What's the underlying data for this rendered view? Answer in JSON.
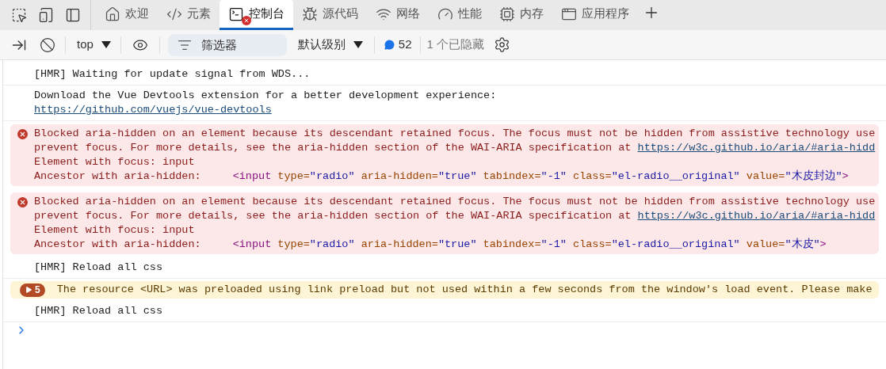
{
  "toolbar": {
    "tools": [
      {
        "kind": "inspect"
      },
      {
        "kind": "device"
      },
      {
        "kind": "dock"
      }
    ],
    "tabs": [
      {
        "kind": "home",
        "label": "欢迎",
        "selected": false,
        "error": false
      },
      {
        "kind": "code",
        "label": "元素",
        "selected": false,
        "error": false
      },
      {
        "kind": "terminal",
        "label": "控制台",
        "selected": true,
        "error": true
      },
      {
        "kind": "bug",
        "label": "源代码",
        "selected": false,
        "error": false
      },
      {
        "kind": "wifi",
        "label": "网络",
        "selected": false,
        "error": false
      },
      {
        "kind": "gauge",
        "label": "性能",
        "selected": false,
        "error": false
      },
      {
        "kind": "chip",
        "label": "内存",
        "selected": false,
        "error": false
      },
      {
        "kind": "window",
        "label": "应用程序",
        "selected": false,
        "error": false
      }
    ]
  },
  "console_bar": {
    "context": "top",
    "filter": {
      "placeholder": "筛选器"
    },
    "level": "默认级别",
    "message_count": "52",
    "hidden": "1 个已隐藏"
  },
  "messages": [
    {
      "kind": "log",
      "lines": [
        "[HMR] Waiting for update signal from WDS..."
      ]
    },
    {
      "kind": "log",
      "lines": [
        "Download the Vue Devtools extension for a better development experience:"
      ],
      "link": "https://github.com/vuejs/vue-devtools"
    },
    {
      "kind": "error",
      "lines": [
        "Blocked aria-hidden on an element because its descendant retained focus. The focus must not be hidden from assistive technology use",
        "prevent focus. For more details, see the aria-hidden section of the WAI-ARIA specification at "
      ],
      "link": "https://w3c.github.io/aria/#aria-hidd",
      "focus": "Element with focus: input",
      "ancestor": "Ancestor with aria-hidden:",
      "snippet": [
        {
          "kind": "tag",
          "text": "<input"
        },
        {
          "kind": "attr",
          "text": "type="
        },
        {
          "kind": "value",
          "text": "\"radio\""
        },
        {
          "kind": "attr",
          "text": "aria-hidden="
        },
        {
          "kind": "value",
          "text": "\"true\""
        },
        {
          "kind": "attr",
          "text": "tabindex="
        },
        {
          "kind": "value",
          "text": "\"-1\""
        },
        {
          "kind": "attr",
          "text": "class="
        },
        {
          "kind": "value",
          "text": "\"el-radio__original\""
        },
        {
          "kind": "attr",
          "text": "value="
        },
        {
          "kind": "value",
          "text": "\"木皮封边\""
        },
        {
          "kind": "end",
          "text": ">"
        }
      ]
    },
    {
      "kind": "error",
      "lines": [
        "Blocked aria-hidden on an element because its descendant retained focus. The focus must not be hidden from assistive technology use",
        "prevent focus. For more details, see the aria-hidden section of the WAI-ARIA specification at "
      ],
      "link": "https://w3c.github.io/aria/#aria-hidd",
      "focus": "Element with focus: input",
      "ancestor": "Ancestor with aria-hidden:",
      "snippet": [
        {
          "kind": "tag",
          "text": "<input"
        },
        {
          "kind": "attr",
          "text": "type="
        },
        {
          "kind": "value",
          "text": "\"radio\""
        },
        {
          "kind": "attr",
          "text": "aria-hidden="
        },
        {
          "kind": "value",
          "text": "\"true\""
        },
        {
          "kind": "attr",
          "text": "tabindex="
        },
        {
          "kind": "value",
          "text": "\"-1\""
        },
        {
          "kind": "attr",
          "text": "class="
        },
        {
          "kind": "value",
          "text": "\"el-radio__original\""
        },
        {
          "kind": "attr",
          "text": "value="
        },
        {
          "kind": "value",
          "text": "\"木皮\""
        },
        {
          "kind": "end",
          "text": ">"
        }
      ]
    },
    {
      "kind": "log",
      "lines": [
        "[HMR] Reload all css"
      ]
    },
    {
      "kind": "warning",
      "count": "5",
      "lines": [
        "The resource <URL> was preloaded using link preload but not used within a few seconds from the window's load event. Please make"
      ]
    },
    {
      "kind": "log",
      "lines": [
        "[HMR] Reload all css"
      ]
    }
  ]
}
